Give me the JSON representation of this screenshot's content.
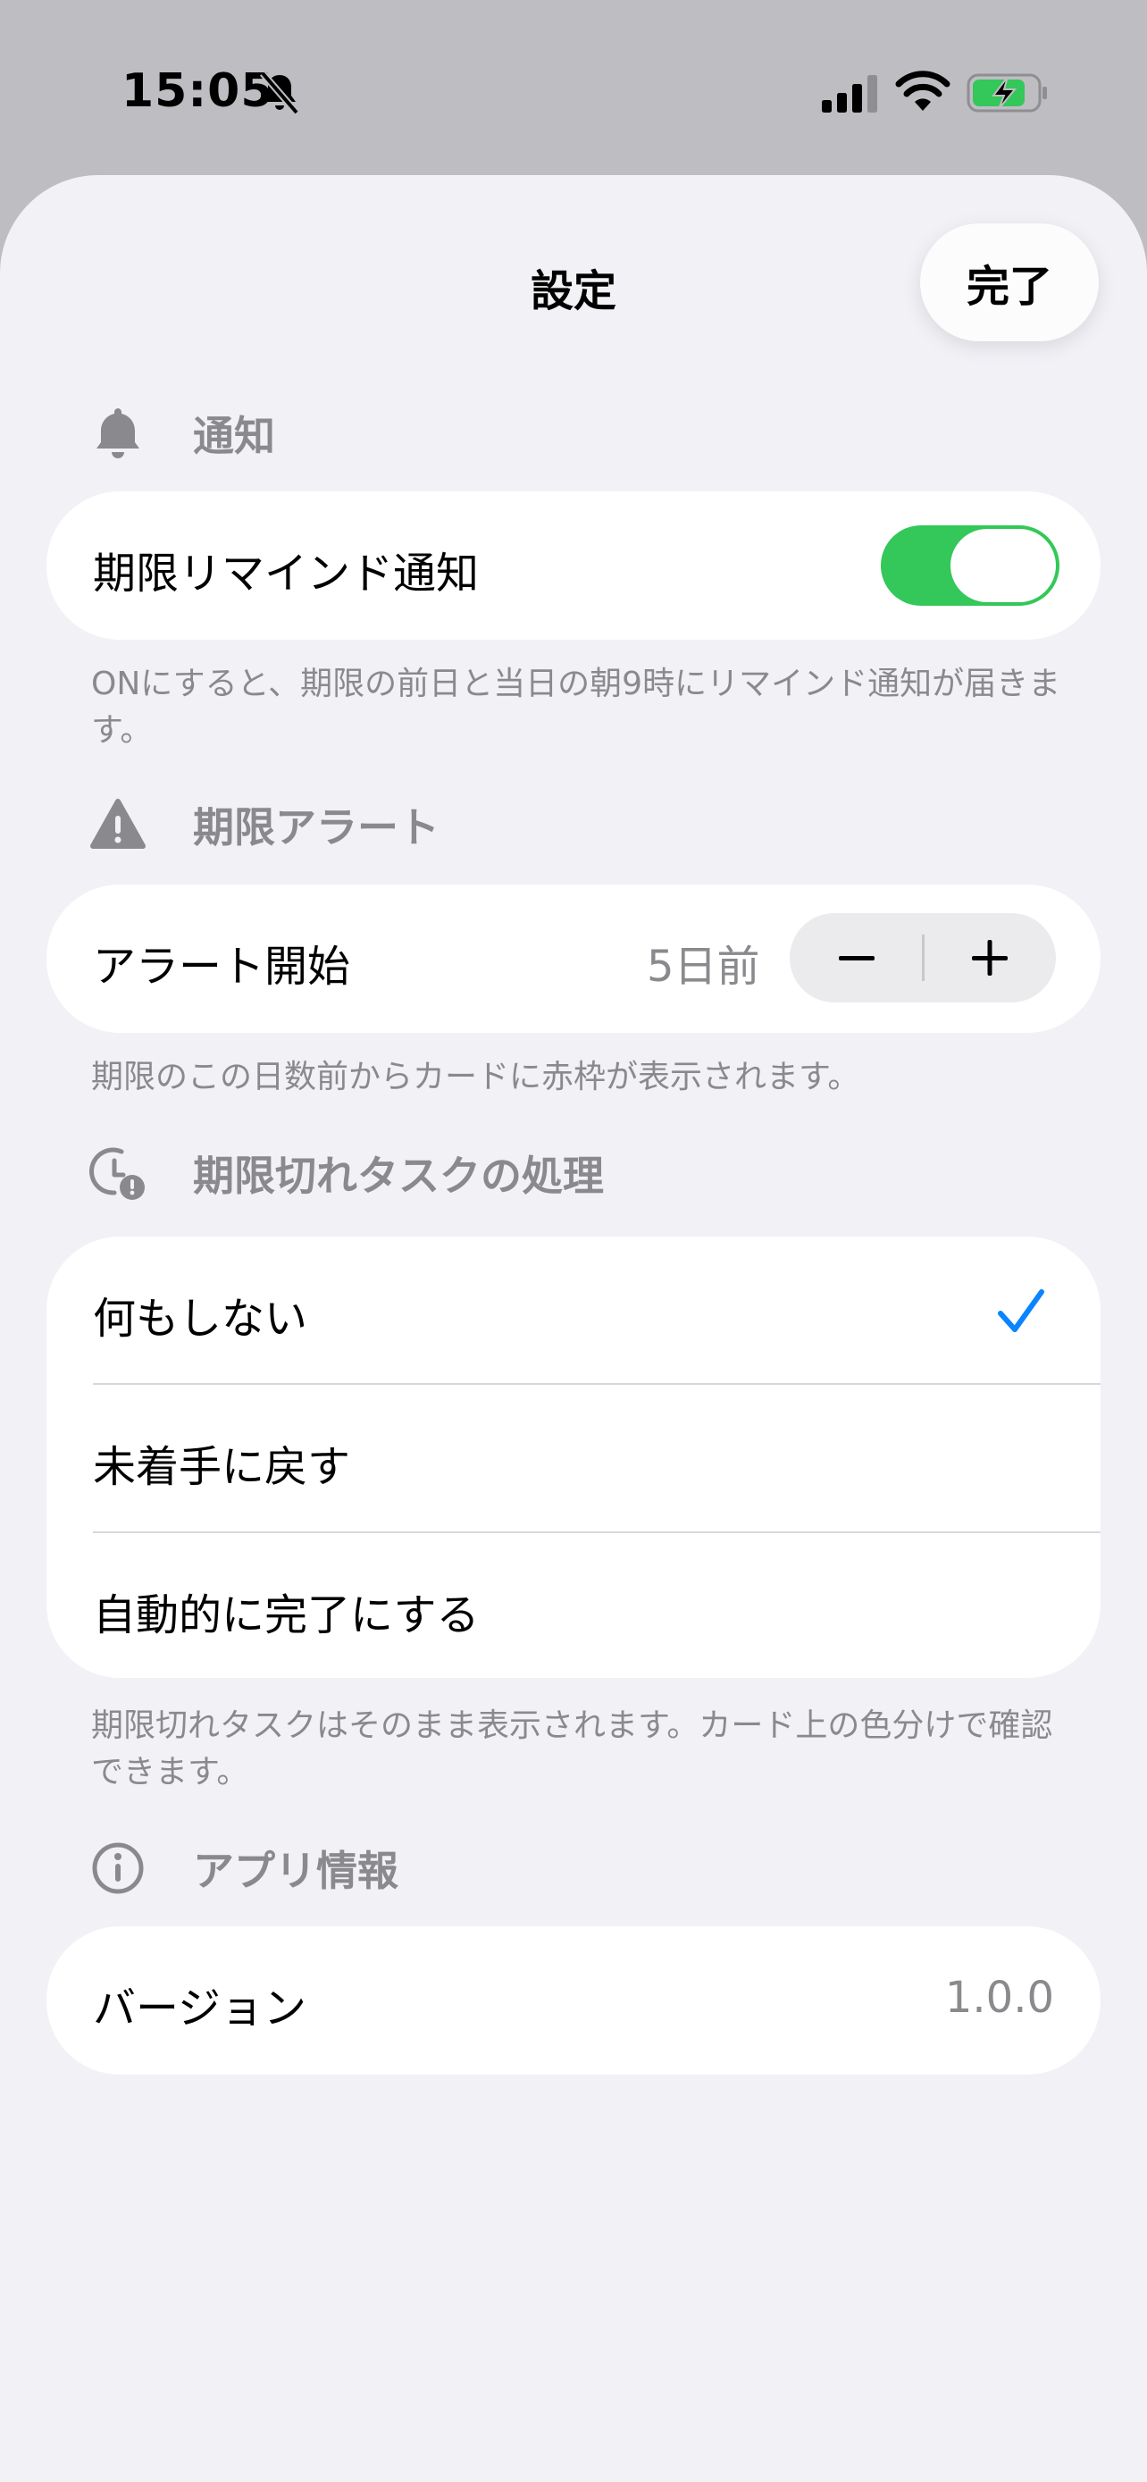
{
  "status_bar": {
    "time": "15:05"
  },
  "header": {
    "title": "設定",
    "done_label": "完了"
  },
  "sections": {
    "notification": {
      "title": "通知",
      "icon": "bell-icon",
      "row_label": "期限リマインド通知",
      "toggle_on": true,
      "footnote": "ONにすると、期限の前日と当日の朝9時にリマインド通知が届きます。"
    },
    "alert": {
      "title": "期限アラート",
      "icon": "warning-icon",
      "row_label": "アラート開始",
      "value": "5日前",
      "footnote": "期限のこの日数前からカードに赤枠が表示されます。"
    },
    "overdue": {
      "title": "期限切れタスクの処理",
      "icon": "clock-alert-icon",
      "options": [
        {
          "label": "何もしない",
          "selected": true
        },
        {
          "label": "未着手に戻す",
          "selected": false
        },
        {
          "label": "自動的に完了にする",
          "selected": false
        }
      ],
      "footnote": "期限切れタスクはそのまま表示されます。カード上の色分けで確認できます。"
    },
    "app_info": {
      "title": "アプリ情報",
      "icon": "info-icon",
      "row_label": "バージョン",
      "version": "1.0.0"
    }
  },
  "colors": {
    "accent": "#34c759",
    "check": "#0a84ff",
    "secondary_text": "#8a8a8e",
    "sheet_bg": "#f1f1f6"
  }
}
